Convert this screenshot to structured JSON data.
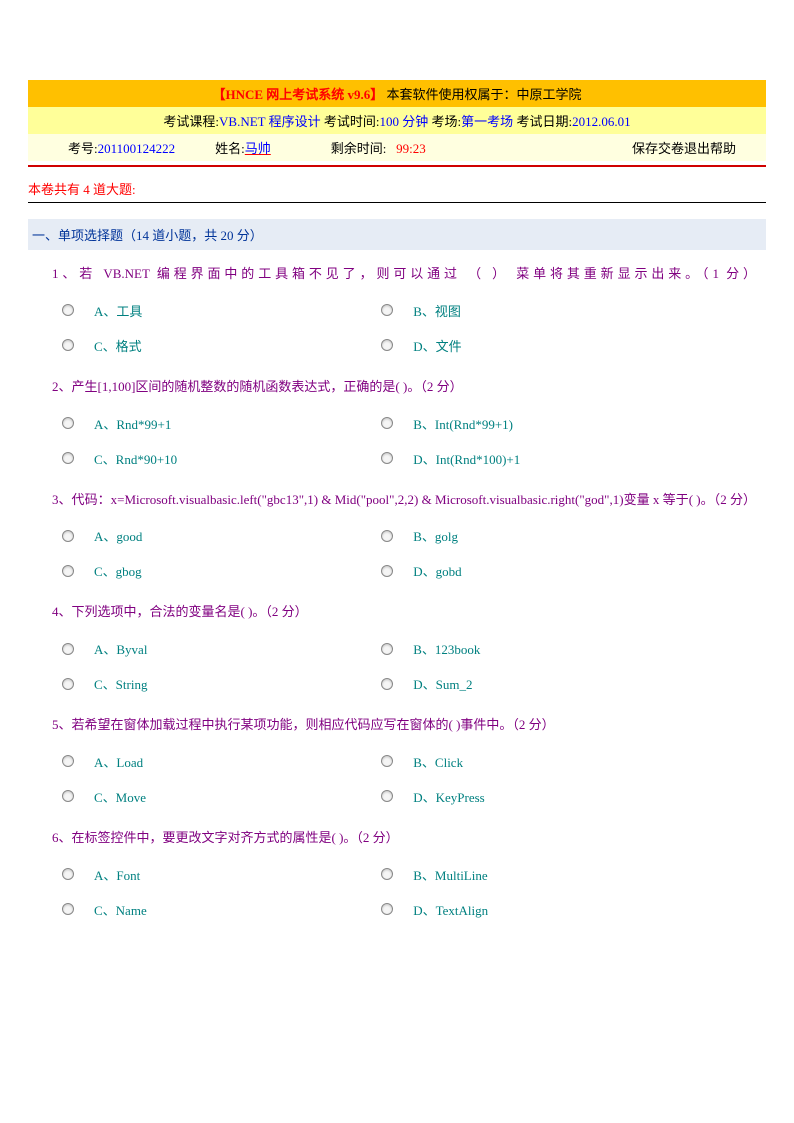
{
  "header1": {
    "system": "【HNCE 网上考试系统 v9.6】",
    "owner_label": "    本套软件使用权属于：",
    "owner_value": "中原工学院"
  },
  "header2": {
    "course_label": "考试课程:",
    "course_value": "VB.NET 程序设计",
    "time_label": "    考试时间:",
    "time_value": "100 分钟",
    "room_label": "    考场:",
    "room_value": "第一考场",
    "date_label": "    考试日期:",
    "date_value": "2012.06.01"
  },
  "header3": {
    "id_label": "考号:",
    "id_value": "201100124222",
    "name_label": "姓名:",
    "name_value": "马帅",
    "remain_label": "剩余时间:",
    "remain_value": "99:23",
    "actions": "保存交卷退出帮助"
  },
  "summary": "本卷共有 4 道大题:",
  "section_title": "一、单项选择题（14 道小题，共 20 分）",
  "questions": [
    {
      "text": "1、若  VB.NET  编程界面中的工具箱不见了，则可以通过 （    ） 菜单将其重新显示出来。（1 分）",
      "justify": true,
      "options": [
        "A、工具",
        "B、视图",
        "C、格式",
        "D、文件"
      ]
    },
    {
      "text": "2、产生[1,100]区间的随机整数的随机函数表达式，正确的是(    )。（2 分）",
      "options": [
        "A、Rnd*99+1",
        "B、Int(Rnd*99+1)",
        "C、Rnd*90+10",
        "D、Int(Rnd*100)+1"
      ]
    },
    {
      "text": "3、代码：x=Microsoft.visualbasic.left(\"gbc13\",1)  &  Mid(\"pool\",2,2)  &  Microsoft.visualbasic.right(\"god\",1)变量 x 等于(     )。（2 分）",
      "justify": true,
      "options": [
        "A、good",
        "B、golg",
        "C、gbog",
        "D、gobd"
      ]
    },
    {
      "text": "4、下列选项中，合法的变量名是(    )。（2 分）",
      "options": [
        "A、Byval",
        "B、123book",
        "C、String",
        "D、Sum_2"
      ]
    },
    {
      "text": "5、若希望在窗体加载过程中执行某项功能，则相应代码应写在窗体的(    )事件中。（2 分）",
      "options": [
        "A、Load",
        "B、Click",
        "C、Move",
        "D、KeyPress"
      ]
    },
    {
      "text": "6、在标签控件中，要更改文字对齐方式的属性是(    )。（2 分）",
      "options": [
        "A、Font",
        "B、MultiLine",
        "C、Name",
        "D、TextAlign"
      ]
    }
  ]
}
